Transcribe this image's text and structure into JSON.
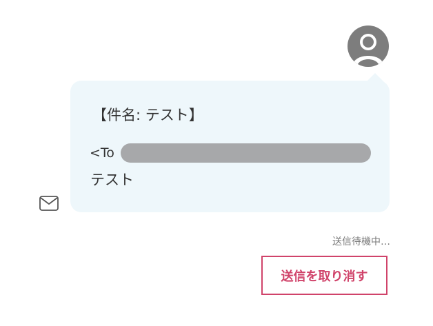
{
  "message": {
    "subject": "【件名: テスト】",
    "to_prefix": "<To",
    "body": "テスト"
  },
  "status": {
    "text": "送信待機中…"
  },
  "actions": {
    "undo_send_label": "送信を取り消す"
  },
  "icons": {
    "avatar": "user-avatar-icon",
    "mail": "envelope-icon"
  },
  "colors": {
    "bubble_bg": "#eef7fb",
    "accent": "#d0436a",
    "avatar_gray": "#7d7d7d",
    "redaction": "#a7a8aa"
  }
}
